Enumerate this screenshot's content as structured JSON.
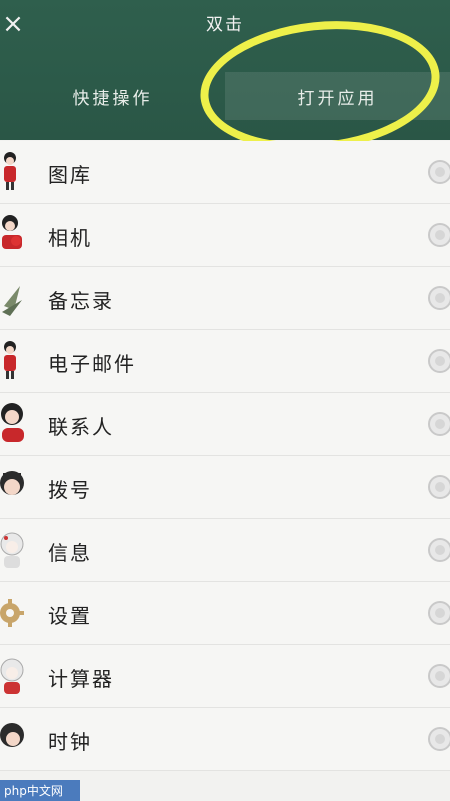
{
  "header": {
    "close_glyph": "×",
    "title": "双击"
  },
  "tabs": [
    {
      "label": "快捷操作"
    },
    {
      "label": "打开应用"
    }
  ],
  "apps": [
    {
      "label": "图库",
      "icon": "girl-red-dress-icon"
    },
    {
      "label": "相机",
      "icon": "girl-with-camera-icon"
    },
    {
      "label": "备忘录",
      "icon": "plant-icon"
    },
    {
      "label": "电子邮件",
      "icon": "girl-red-dress-icon"
    },
    {
      "label": "联系人",
      "icon": "girl-red-dress-icon"
    },
    {
      "label": "拨号",
      "icon": "girl-face-icon"
    },
    {
      "label": "信息",
      "icon": "girl-white-icon"
    },
    {
      "label": "设置",
      "icon": "gear-icon"
    },
    {
      "label": "计算器",
      "icon": "girl-white-icon"
    },
    {
      "label": "时钟",
      "icon": "girl-face-icon"
    }
  ],
  "watermark": "php中文网"
}
